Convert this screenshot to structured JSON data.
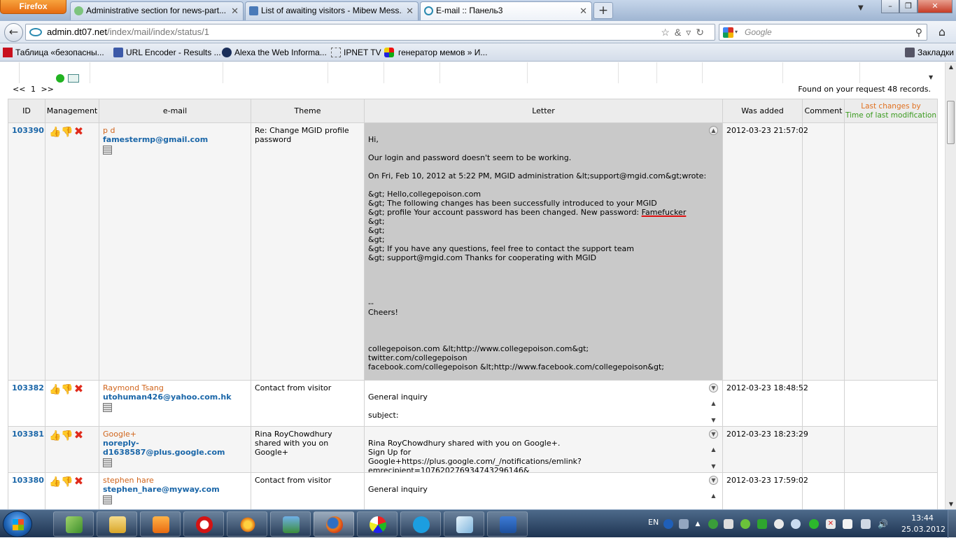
{
  "browser": {
    "menu_label": "Firefox",
    "tabs": [
      {
        "label": "Administrative section for news-part..."
      },
      {
        "label": "List of awaiting visitors - Mibew Mess..."
      },
      {
        "label": "E-mail :: Панель3"
      }
    ],
    "new_tab_symbol": "+",
    "window_controls": {
      "minimize": "–",
      "maximize": "❐",
      "close": "✕"
    },
    "url": {
      "host": "admin.dt07.net",
      "path": "/index/mail/index/status/1"
    },
    "search_placeholder": "Google",
    "bookmarks": [
      {
        "label": "Таблица «безопасны...",
        "icon": "red-grid-icon"
      },
      {
        "label": "URL Encoder - Results ...",
        "icon": "url-encoder-icon"
      },
      {
        "label": "Alexa the Web Informa...",
        "icon": "alexa-icon"
      },
      {
        "label": "IPNET TV",
        "icon": "page-icon"
      },
      {
        "label": "генератор мемов » И...",
        "icon": "meme-icon"
      }
    ],
    "bookmarks_menu": "Закладки"
  },
  "page": {
    "pager": {
      "prev": "<<",
      "current": "1",
      "next": ">>"
    },
    "found_text": "Found on your request 48 records.",
    "columns": {
      "id": "ID",
      "management": "Management",
      "email": "e-mail",
      "theme": "Theme",
      "letter": "Letter",
      "was_added": "Was added",
      "comment": "Comment",
      "last_changes_by": "Last changes by",
      "time_of_last_modification": "Time of last modification"
    },
    "rows": [
      {
        "id": "103390",
        "sender_name": "p d",
        "sender_email": "famestermp@gmail.com",
        "theme": "Re: Change MGID profile password",
        "letter_before": "\nHi,\n\nOur login and password doesn't seem to be working.\n\nOn Fri, Feb 10, 2012 at 5:22 PM, MGID administration &lt;support@mgid.com&gt;wrote:\n\n&gt; Hello,collegepoison.com\n&gt; The following changes has been successfully introduced to your MGID\n&gt; profile Your account password has been changed. New password: ",
        "letter_password": "Famefucker",
        "letter_after": "\n&gt;\n&gt;\n&gt;\n&gt; If you have any questions, feel free to contact the support team\n&gt; support@mgid.com Thanks for cooperating with MGID\n\n\n\n\n--\nCheers!\n\n\n\ncollegepoison.com &lt;http://www.collegepoison.com&gt;\ntwitter.com/collegepoison\nfacebook.com/collegepoison &lt;http://www.facebook.com/collegepoison&gt;",
        "was_added": "2012-03-23 21:57:02",
        "comment": "",
        "last_changes": ""
      },
      {
        "id": "103382",
        "sender_name": "Raymond Tsang",
        "sender_email": "utohuman426@yahoo.com.hk",
        "theme": "Contact from visitor",
        "letter": "\nGeneral inquiry\n\nsubject:",
        "was_added": "2012-03-23 18:48:52",
        "comment": "",
        "last_changes": ""
      },
      {
        "id": "103381",
        "sender_name": "Google+",
        "sender_email": "noreply-d1638587@plus.google.com",
        "theme": "Rina RoyChowdhury shared with you on Google+",
        "letter": "\nRina RoyChowdhury shared with you on Google+.\nSign Up for\nGoogle+https://plus.google.com/_/notifications/emlink?emrecipient=107620276934743296146&",
        "was_added": "2012-03-23 18:23:29",
        "comment": "",
        "last_changes": ""
      },
      {
        "id": "103380",
        "sender_name": "stephen hare",
        "sender_email": "stephen_hare@myway.com",
        "theme": "Contact from visitor",
        "letter": "\nGeneral inquiry",
        "was_added": "2012-03-23 17:59:02",
        "comment": "",
        "last_changes": ""
      }
    ]
  },
  "taskbar": {
    "apps": [
      "explorer",
      "file-manager",
      "media-player",
      "opera",
      "flower-app",
      "image-viewer",
      "firefox",
      "paint",
      "skype",
      "notes",
      "word"
    ],
    "language": "EN",
    "time": "13:44",
    "date": "25.03.2012"
  },
  "colors": {
    "accent_link": "#1a66a8",
    "sender_name": "#d0641b",
    "last_changes": "#e07020",
    "time_modification": "#3b9b1f",
    "password_underline": "#e01010",
    "expanded_letter_bg": "#c9c9c9"
  }
}
